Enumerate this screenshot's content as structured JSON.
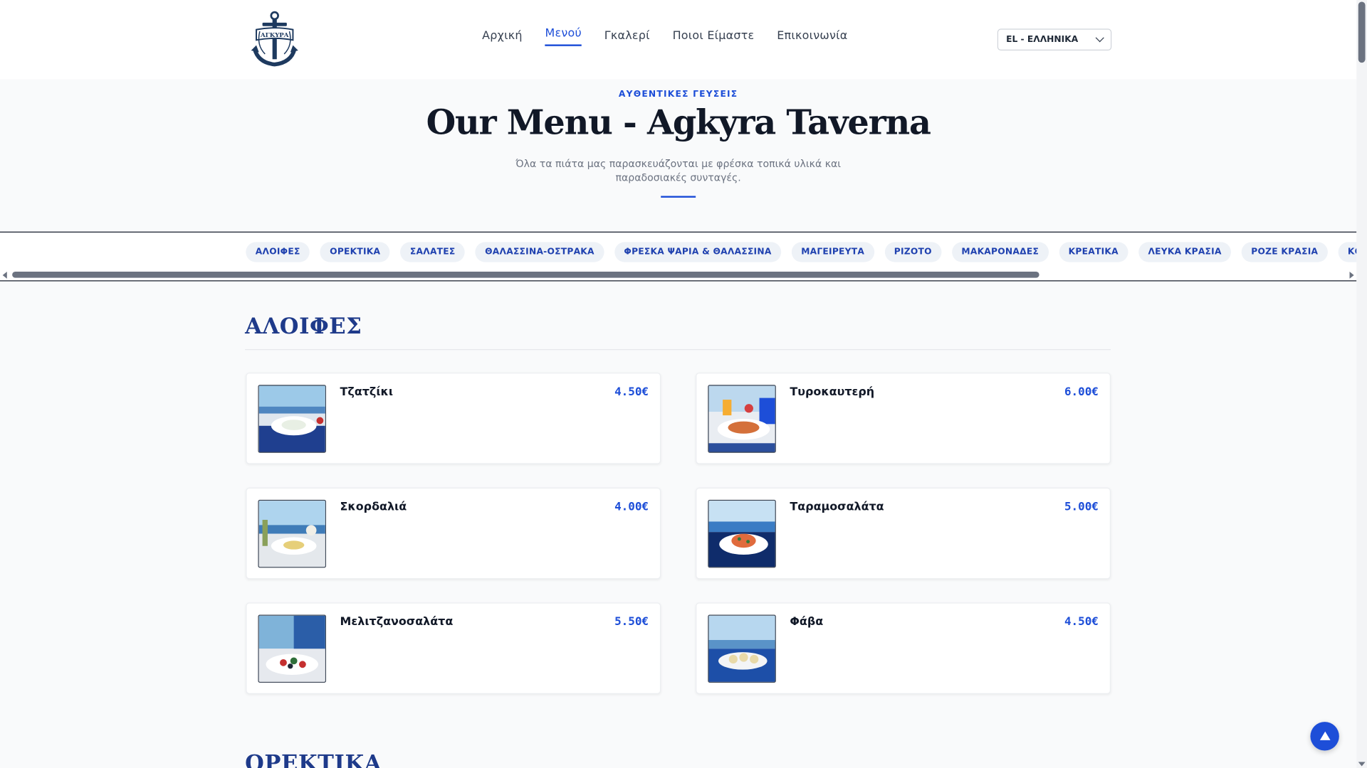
{
  "header": {
    "logo_text": "ΑΓΚΥΡΑ",
    "nav": [
      {
        "label": "Αρχική",
        "active": false
      },
      {
        "label": "Μενού",
        "active": true
      },
      {
        "label": "Γκαλερί",
        "active": false
      },
      {
        "label": "Ποιοι Είμαστε",
        "active": false
      },
      {
        "label": "Επικοινωνία",
        "active": false
      }
    ],
    "language": "EL - ΕΛΛΗΝΙΚΑ"
  },
  "hero": {
    "kicker": "ΑΥΘΕΝΤΙΚΕΣ ΓΕΥΣΕΙΣ",
    "title": "Our Menu - Agkyra Taverna",
    "subtitle": "Όλα τα πιάτα μας παρασκευάζονται με φρέσκα τοπικά υλικά και παραδοσιακές συνταγές."
  },
  "categories": [
    "ΑΛΟΙΦΕΣ",
    "ΟΡΕΚΤΙΚΑ",
    "ΣΑΛΑΤΕΣ",
    "ΘΑΛΑΣΣΙΝΑ-ΟΣΤΡΑΚΑ",
    "ΦΡΕΣΚΑ ΨΑΡΙΑ & ΘΑΛΑΣΣΙΝΑ",
    "ΜΑΓΕΙΡΕΥΤΑ",
    "ΡΙΖΟΤΟ",
    "ΜΑΚΑΡΟΝΑΔΕΣ",
    "ΚΡΕΑΤΙΚΑ",
    "ΛΕΥΚΑ ΚΡΑΣΙΑ",
    "ΡΟΖΕ ΚΡΑΣΙΑ",
    "ΚΟΚΚΙΝΑ ΚΡΑΣΙΑ"
  ],
  "section": {
    "title": "ΑΛΟΙΦΕΣ",
    "items": [
      {
        "name": "Τζατζίκι",
        "price": "4.50€"
      },
      {
        "name": "Τυροκαυτερή",
        "price": "6.00€"
      },
      {
        "name": "Σκορδαλιά",
        "price": "4.00€"
      },
      {
        "name": "Ταραμοσαλάτα",
        "price": "5.00€"
      },
      {
        "name": "Μελιτζανοσαλάτα",
        "price": "5.50€"
      },
      {
        "name": "Φάβα",
        "price": "4.50€"
      }
    ]
  },
  "next_section_title": "ΟΡΕΚΤΙΚΑ",
  "colors": {
    "accent": "#1d4ed8",
    "heading_navy": "#1e3a8a",
    "background": "#f9fafb"
  }
}
